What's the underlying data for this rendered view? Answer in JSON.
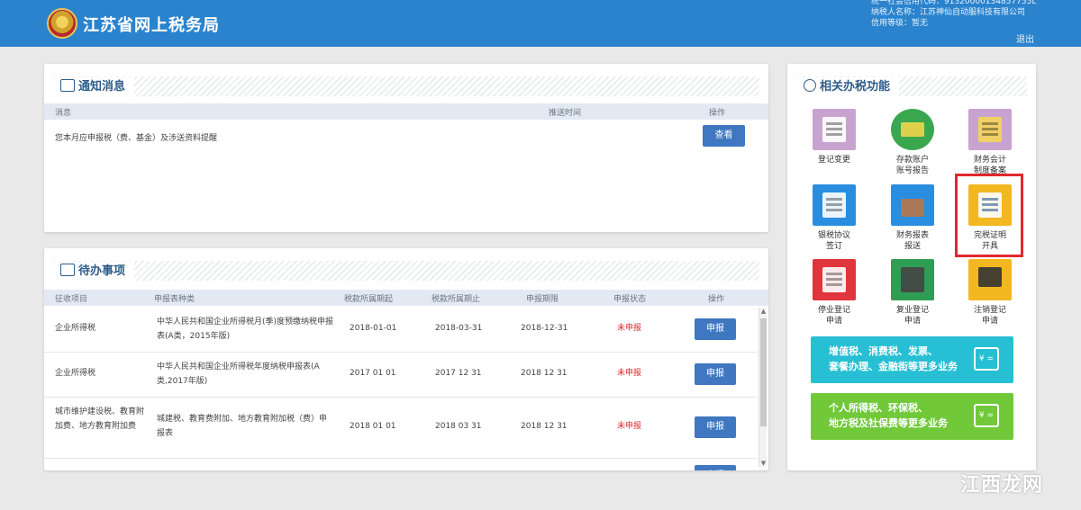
{
  "header": {
    "site_title": "江苏省网上税务局",
    "credit_code": "统一社会信用代码：91320000134857755L",
    "taxpayer_name": "纳税人名称：江苏神仙自动服科技有限公司",
    "credit_level": "信用等级：暂无",
    "logout": "退出"
  },
  "notice": {
    "title": "通知消息",
    "columns": [
      "消息",
      "推送时间",
      "操作"
    ],
    "rows": [
      {
        "message": "您本月应申报税（费、基金）及涉送资料提醒",
        "time": "",
        "action": "查看"
      }
    ]
  },
  "todo": {
    "title": "待办事项",
    "columns": [
      "征收项目",
      "申报表种类",
      "税款所属期起",
      "税款所属期止",
      "申报期限",
      "申报状态",
      "操作"
    ],
    "rows": [
      {
        "item": "企业所得税",
        "form": "中华人民共和国企业所得税月(季)度预缴纳税申报表(A类，2015年版)",
        "start": "2018-01-01",
        "end": "2018-03-31",
        "deadline": "2018-12-31",
        "status": "未申报",
        "action": "申报"
      },
      {
        "item": "企业所得税",
        "form": "中华人民共和国企业所得税年度纳税申报表(A类,2017年版)",
        "start": "2017 01 01",
        "end": "2017 12 31",
        "deadline": "2018 12 31",
        "status": "未申报",
        "action": "申报"
      },
      {
        "item": "城市维护建设税、教育附加费、地方教育附加费",
        "form": "城建税、教育费附加、地方教育附加税（费）申报表",
        "start": "2018 01 01",
        "end": "2018 03 31",
        "deadline": "2018 12 31",
        "status": "未申报",
        "action": "申报"
      },
      {
        "item": "",
        "form": "",
        "start": "",
        "end": "",
        "deadline": "",
        "status": "",
        "action": "申报"
      }
    ]
  },
  "functions": {
    "title": "相关办税功能",
    "tiles": [
      {
        "label1": "登记变更",
        "label2": "",
        "color": "#c9a3cf",
        "icon": "registration-icon"
      },
      {
        "label1": "存款账户",
        "label2": "账号报告",
        "color": "#3aa74f",
        "icon": "bank-card-icon"
      },
      {
        "label1": "财务会计",
        "label2": "制度备案",
        "color": "#c9a3cf",
        "icon": "accounting-icon"
      },
      {
        "label1": "银税协议",
        "label2": "签订",
        "color": "#2a8ee0",
        "icon": "agreement-icon"
      },
      {
        "label1": "财务报表",
        "label2": "报送",
        "color": "#2a8ee0",
        "icon": "briefcase-icon"
      },
      {
        "label1": "完税证明",
        "label2": "开具",
        "color": "#f2b721",
        "icon": "certificate-icon"
      },
      {
        "label1": "停业登记",
        "label2": "申请",
        "color": "#e0353a",
        "icon": "suspend-icon"
      },
      {
        "label1": "复业登记",
        "label2": "申请",
        "color": "#2f9e55",
        "icon": "resume-icon"
      },
      {
        "label1": "注销登记",
        "label2": "申请",
        "color": "#f2b721",
        "icon": "cancel-registration-icon"
      }
    ],
    "banner1": {
      "line1": "增值税、消费税、发票、",
      "line2": "套餐办理、金融街等更多业务",
      "tag": "¥ =",
      "color": "#27bfd3"
    },
    "banner2": {
      "line1": "个人所得税、环保税、",
      "line2": "地方税及社保费等更多业务",
      "tag": "¥ =",
      "color": "#71c93a"
    }
  },
  "watermark": "江西龙网"
}
